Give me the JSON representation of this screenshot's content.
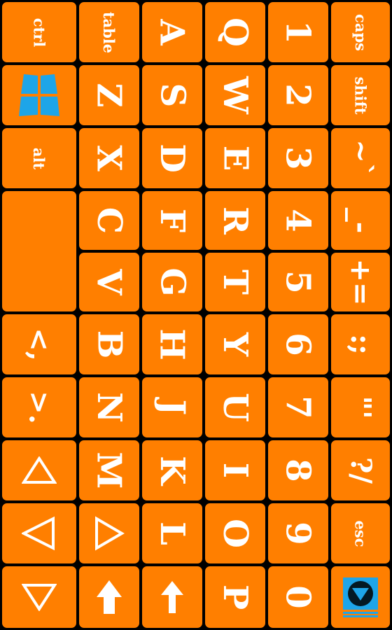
{
  "colors": {
    "key": "#ff7f00",
    "text": "#ffffff",
    "border": "#000000",
    "accent": "#1ea5e8"
  },
  "keys": {
    "ctrl": "ctrl",
    "table": "table",
    "a": "A",
    "q": "Q",
    "one": "1",
    "caps": "caps",
    "z": "Z",
    "s": "S",
    "w": "W",
    "two": "2",
    "shift": "shift",
    "alt": "alt",
    "x": "X",
    "d": "D",
    "e": "E",
    "three": "3",
    "tilde": "~`",
    "c": "C",
    "f": "F",
    "r": "R",
    "four": "4",
    "minus": "_-",
    "v": "V",
    "g": "G",
    "t": "T",
    "five": "5",
    "plus": "+=",
    "lt": "<,",
    "b": "B",
    "h": "H",
    "y": "Y",
    "six": "6",
    "colon": ":;",
    "gt": ">.",
    "n": "N",
    "j": "J",
    "u": "U",
    "seven": "7",
    "quote": "\"'",
    "m": "M",
    "k": "K",
    "i": "I",
    "eight": "8",
    "question": "?/",
    "l": "L",
    "o": "O",
    "nine": "9",
    "esc": "esc",
    "p": "P",
    "zero": "0"
  },
  "icons": {
    "windows": "windows-logo-icon",
    "arrow_up": "triangle-up-icon",
    "arrow_left": "triangle-left-icon",
    "arrow_down": "triangle-down-icon",
    "arrow_right": "triangle-right-icon",
    "shift_arrow": "shift-arrow-icon",
    "up_arrow": "up-arrow-icon",
    "hide_keyboard": "hide-keyboard-icon"
  }
}
